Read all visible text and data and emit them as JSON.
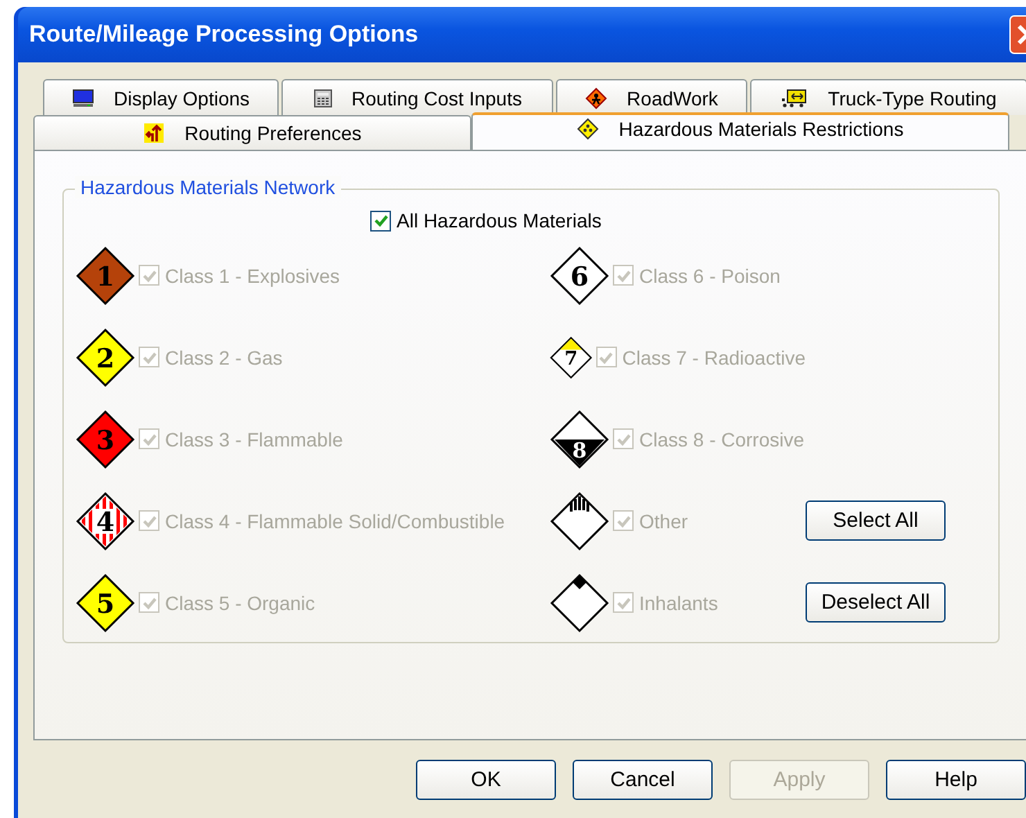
{
  "window": {
    "title": "Route/Mileage Processing Options"
  },
  "tabs": [
    [
      {
        "label": "Display Options",
        "selected": false
      },
      {
        "label": "Routing Cost Inputs",
        "selected": false
      },
      {
        "label": "RoadWork",
        "selected": false
      },
      {
        "label": "Truck-Type Routing",
        "selected": false
      }
    ],
    [
      {
        "label": "Routing Preferences",
        "selected": false
      },
      {
        "label": "Hazardous Materials Restrictions",
        "selected": true
      }
    ]
  ],
  "group": {
    "title": "Hazardous Materials Network",
    "all": {
      "label": "All Hazardous Materials",
      "checked": true
    }
  },
  "rows": [
    {
      "left": {
        "kind": "explosive",
        "number": "1",
        "label": "Class 1 - Explosives",
        "checked": true,
        "disabled": true
      },
      "right": {
        "kind": "poison",
        "number": "6",
        "label": "Class 6 - Poison",
        "checked": true,
        "disabled": true
      }
    },
    {
      "left": {
        "kind": "gas",
        "number": "2",
        "label": "Class 2 - Gas",
        "checked": true,
        "disabled": true
      },
      "right": {
        "kind": "radioactive",
        "number": "7",
        "label": "Class 7 - Radioactive",
        "checked": true,
        "disabled": true
      }
    },
    {
      "left": {
        "kind": "flammable",
        "number": "3",
        "label": "Class 3 - Flammable",
        "checked": true,
        "disabled": true
      },
      "right": {
        "kind": "corrosive",
        "number": "8",
        "label": "Class 8 - Corrosive",
        "checked": true,
        "disabled": true
      }
    },
    {
      "left": {
        "kind": "solid",
        "number": "4",
        "label": "Class 4 - Flammable Solid/Combustible",
        "checked": true,
        "disabled": true
      },
      "right": {
        "kind": "other",
        "label": "Other",
        "checked": true,
        "disabled": true
      },
      "button": "Select All"
    },
    {
      "left": {
        "kind": "organic",
        "number": "5",
        "label": "Class 5 - Organic",
        "checked": true,
        "disabled": true
      },
      "right": {
        "kind": "inhalant",
        "label": "Inhalants",
        "checked": true,
        "disabled": true
      },
      "button": "Deselect All"
    }
  ],
  "buttons": [
    {
      "label": "OK",
      "disabled": false
    },
    {
      "label": "Cancel",
      "disabled": false
    },
    {
      "label": "Apply",
      "disabled": true
    },
    {
      "label": "Help",
      "disabled": false
    }
  ]
}
